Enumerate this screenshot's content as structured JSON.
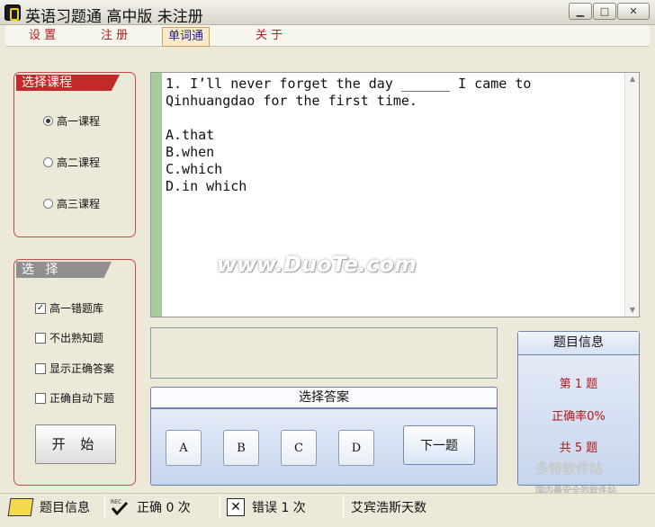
{
  "window": {
    "title": "英语习题通 高中版 未注册",
    "minimize": "▁",
    "maximize": "□",
    "close": "✕"
  },
  "menu": {
    "settings": "设 置",
    "register": "注 册",
    "vocab": "单词通",
    "about": "关 于"
  },
  "course_panel": {
    "title": "选择课程",
    "options": [
      "高一课程",
      "高二课程",
      "高三课程"
    ],
    "selected_index": 0
  },
  "select_panel": {
    "title": "选 择",
    "options": [
      {
        "label": "高一错题库",
        "checked": true
      },
      {
        "label": "不出熟知题",
        "checked": false
      },
      {
        "label": "显示正确答案",
        "checked": false
      },
      {
        "label": "正确自动下题",
        "checked": false
      }
    ],
    "start_label": "开 始"
  },
  "question": {
    "text": "1. I’ll never forget the day ______ I came to\nQinhuangdao for the first time.\n\nA.that\nB.when\nC.which\nD.in which"
  },
  "watermark": "www.DuoTe.com",
  "answers": {
    "title": "选择答案",
    "buttons": [
      "A",
      "B",
      "C",
      "D"
    ],
    "next_label": "下一题"
  },
  "info": {
    "title": "题目信息",
    "current": "第  1  题",
    "accuracy": "正确率0%",
    "total": "共  5  题"
  },
  "logo_wm": {
    "name": "多特软件站",
    "sub": "国内最安全的软件站"
  },
  "statusbar": {
    "info_label": "题目信息",
    "correct_label": "正确  0  次",
    "wrong_label": "错误  1  次",
    "user_text": "艾宾浩斯天数"
  }
}
